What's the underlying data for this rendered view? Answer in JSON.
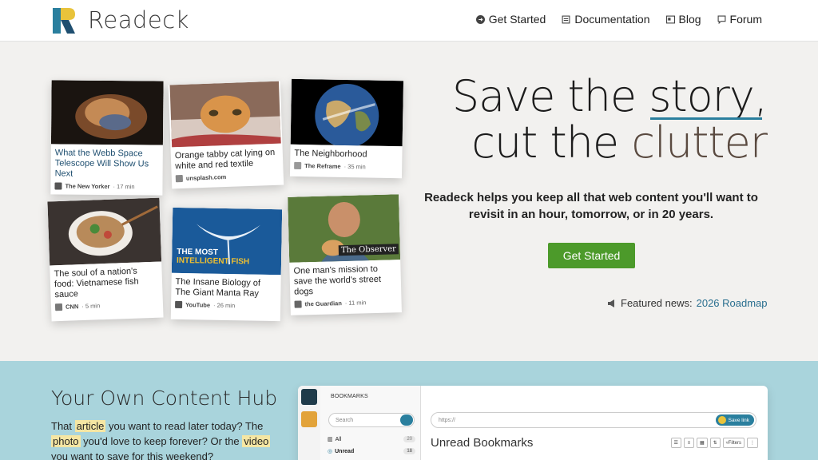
{
  "header": {
    "brand": "Readeck",
    "nav": [
      {
        "label": "Get Started",
        "icon": "arrow-circle-icon"
      },
      {
        "label": "Documentation",
        "icon": "docs-icon"
      },
      {
        "label": "Blog",
        "icon": "blog-icon"
      },
      {
        "label": "Forum",
        "icon": "chat-bubble-icon"
      }
    ]
  },
  "hero": {
    "headline_part1": "Save the",
    "headline_story": "story,",
    "headline_part2": "cut the",
    "headline_clutter": "clutter",
    "subtitle": "Readeck helps you keep all that web content you'll want to revisit in an hour, tomorrow, or in 20 years.",
    "cta": "Get Started",
    "news_label": "Featured news:",
    "news_link": "2026 Roadmap"
  },
  "cards": [
    {
      "title": "What the Webb Space Telescope Will Show Us Next",
      "source": "The New Yorker",
      "time": "17 min"
    },
    {
      "title": "Orange tabby cat lying on white and red textile",
      "source": "unsplash.com",
      "time": ""
    },
    {
      "title": "The Neighborhood",
      "source": "The Reframe",
      "time": "35 min"
    },
    {
      "title": "The soul of a nation's food: Vietnamese fish sauce",
      "source": "CNN",
      "time": "5 min"
    },
    {
      "title": "The Insane Biology of The Giant Manta Ray",
      "source": "YouTube",
      "time": "26 min",
      "overlay1": "THE MOST",
      "overlay2": "INTELLIGENT FISH"
    },
    {
      "title": "One man's mission to save the world's street dogs",
      "source": "the Guardian",
      "time": "11 min",
      "overlay": "The Observer"
    }
  ],
  "lower": {
    "title": "Your Own Content Hub",
    "text_1": "That",
    "hl_1": "article",
    "text_2": "you want to read later today? The",
    "hl_2": "photo",
    "text_3": "you'd love to keep forever? Or the",
    "hl_3": "video",
    "text_4": "you want to save for this weekend?"
  },
  "app": {
    "side_title": "BOOKMARKS",
    "search_placeholder": "Search",
    "items": [
      {
        "label": "All",
        "count": "20"
      },
      {
        "label": "Unread",
        "count": "18"
      }
    ],
    "url_placeholder": "https://",
    "save_label": "Save link",
    "main_title": "Unread Bookmarks",
    "filters_label": "Filters"
  },
  "colors": {
    "accent": "#2a7f9e",
    "cta_green": "#4c9a2a",
    "lower_bg": "#a9d4dc",
    "highlight": "#f5e6a3"
  }
}
